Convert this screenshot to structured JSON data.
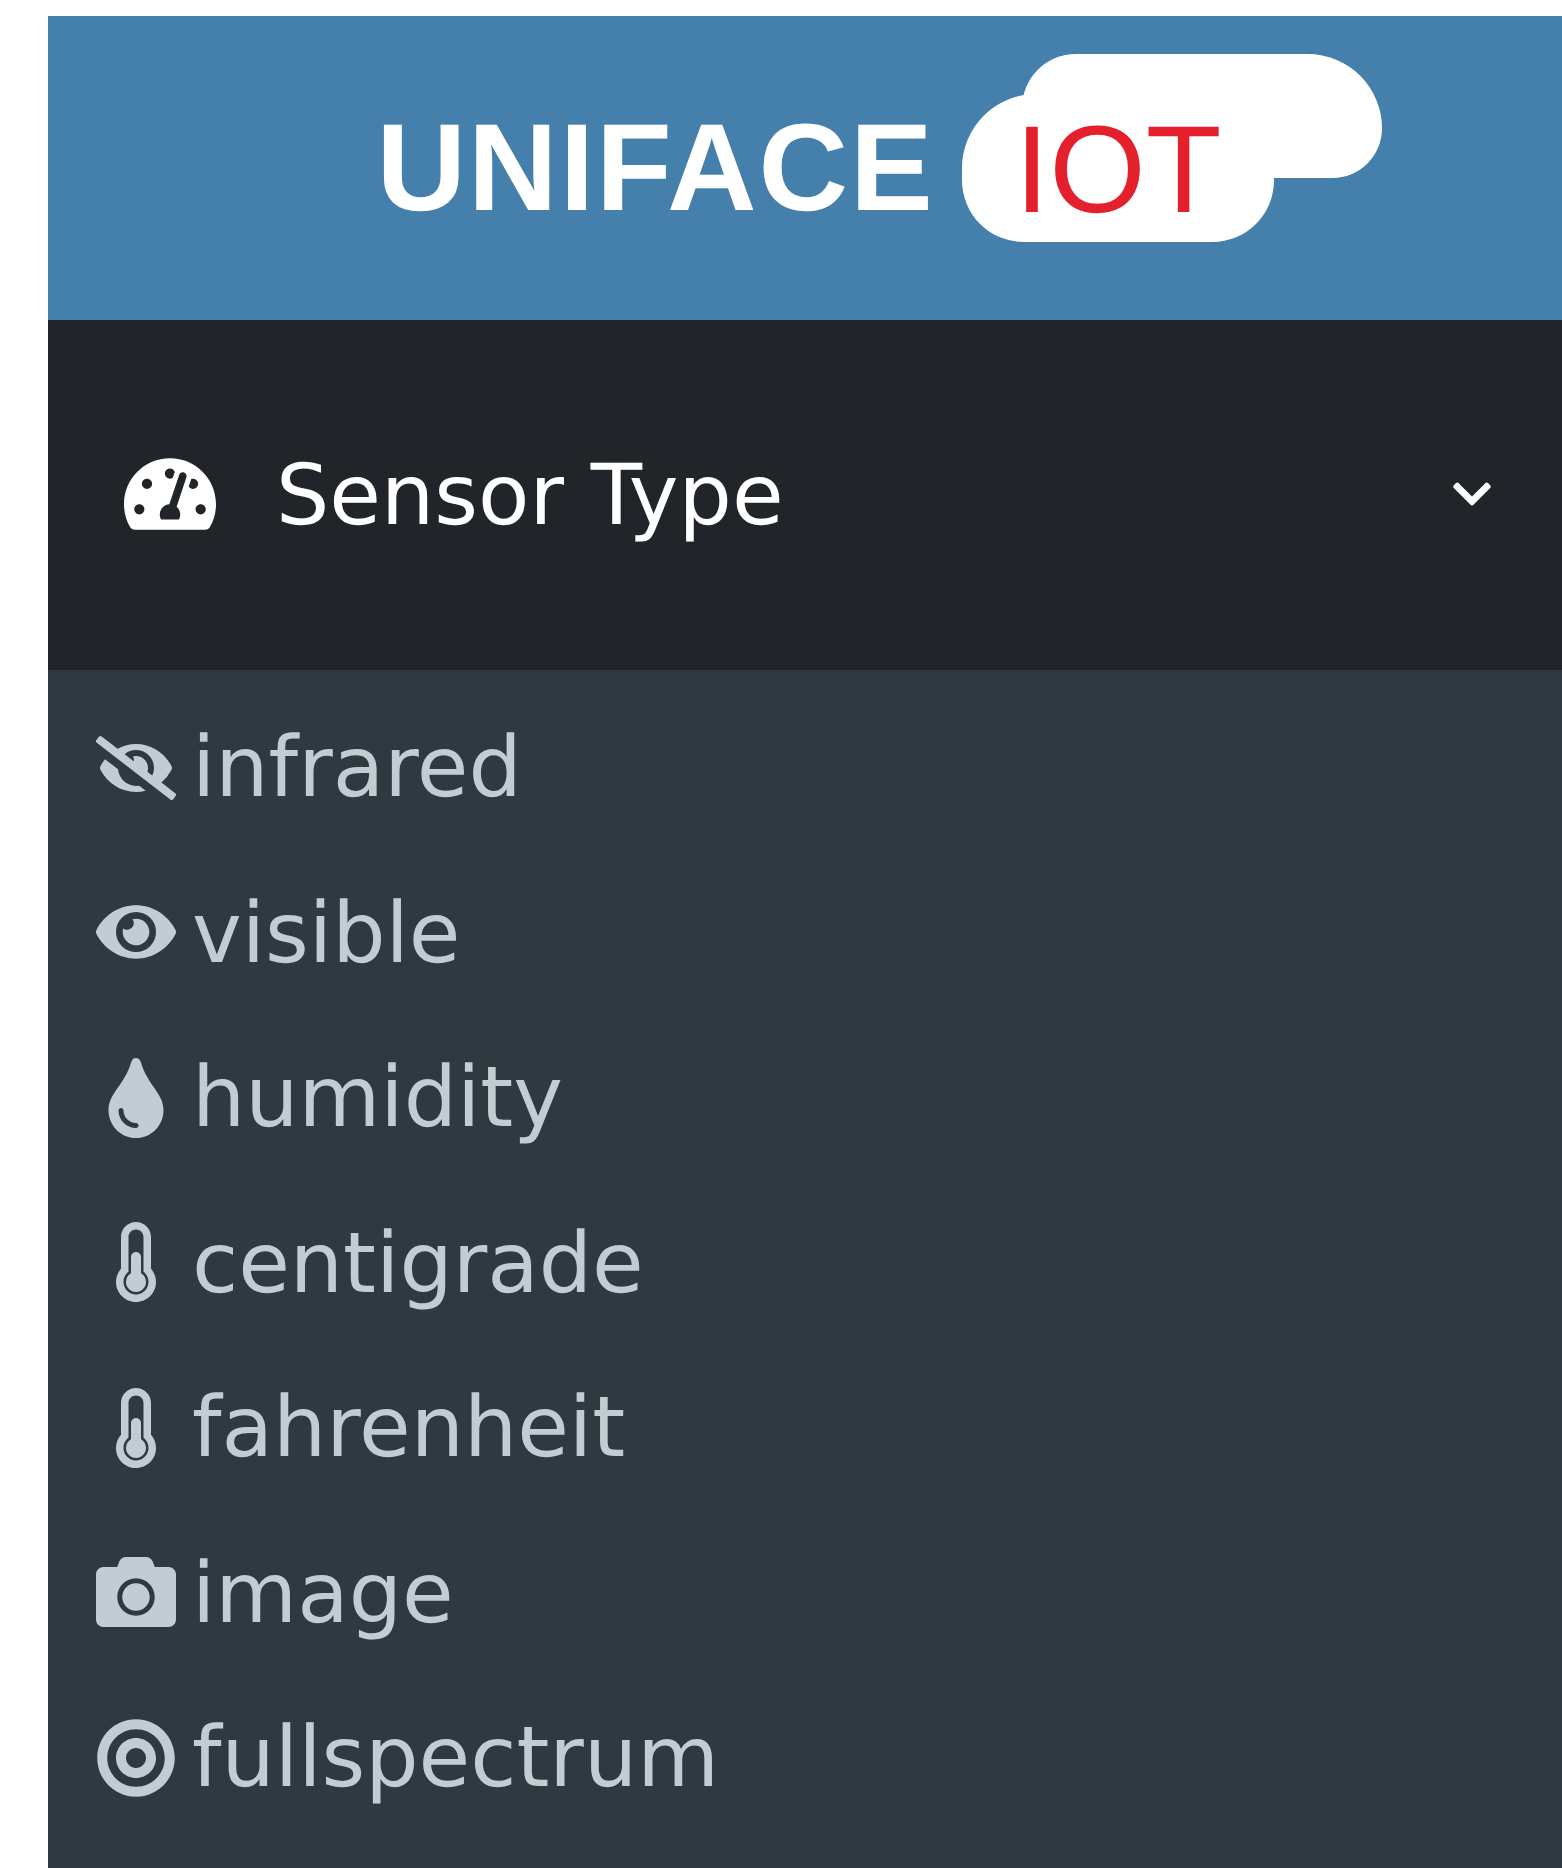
{
  "logo": {
    "brand": "UNIFACE",
    "badge": "IOT"
  },
  "menu": {
    "title": "Sensor Type",
    "expanded": true,
    "items": [
      {
        "label": "infrared"
      },
      {
        "label": "visible"
      },
      {
        "label": "humidity"
      },
      {
        "label": "centigrade"
      },
      {
        "label": "fahrenheit"
      },
      {
        "label": "image"
      },
      {
        "label": "fullspectrum"
      }
    ]
  }
}
